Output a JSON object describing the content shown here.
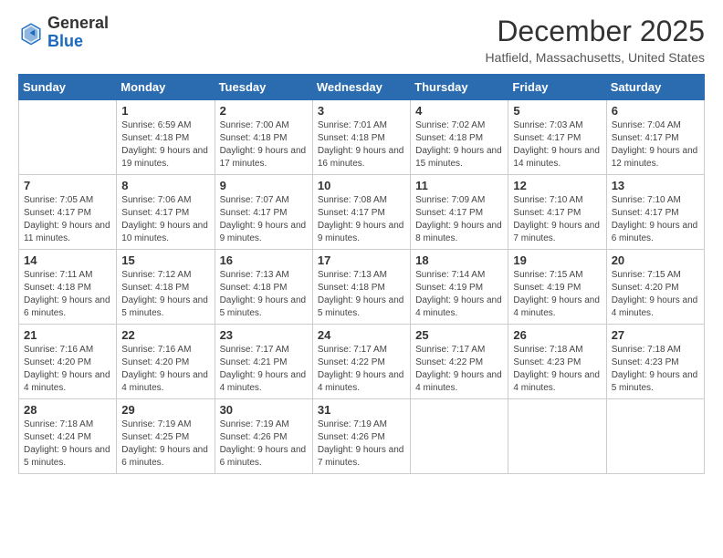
{
  "header": {
    "logo_general": "General",
    "logo_blue": "Blue",
    "month_year": "December 2025",
    "location": "Hatfield, Massachusetts, United States"
  },
  "days_of_week": [
    "Sunday",
    "Monday",
    "Tuesday",
    "Wednesday",
    "Thursday",
    "Friday",
    "Saturday"
  ],
  "weeks": [
    [
      {
        "day": "",
        "sunrise": "",
        "sunset": "",
        "daylight": ""
      },
      {
        "day": "1",
        "sunrise": "Sunrise: 6:59 AM",
        "sunset": "Sunset: 4:18 PM",
        "daylight": "Daylight: 9 hours and 19 minutes."
      },
      {
        "day": "2",
        "sunrise": "Sunrise: 7:00 AM",
        "sunset": "Sunset: 4:18 PM",
        "daylight": "Daylight: 9 hours and 17 minutes."
      },
      {
        "day": "3",
        "sunrise": "Sunrise: 7:01 AM",
        "sunset": "Sunset: 4:18 PM",
        "daylight": "Daylight: 9 hours and 16 minutes."
      },
      {
        "day": "4",
        "sunrise": "Sunrise: 7:02 AM",
        "sunset": "Sunset: 4:18 PM",
        "daylight": "Daylight: 9 hours and 15 minutes."
      },
      {
        "day": "5",
        "sunrise": "Sunrise: 7:03 AM",
        "sunset": "Sunset: 4:17 PM",
        "daylight": "Daylight: 9 hours and 14 minutes."
      },
      {
        "day": "6",
        "sunrise": "Sunrise: 7:04 AM",
        "sunset": "Sunset: 4:17 PM",
        "daylight": "Daylight: 9 hours and 12 minutes."
      }
    ],
    [
      {
        "day": "7",
        "sunrise": "Sunrise: 7:05 AM",
        "sunset": "Sunset: 4:17 PM",
        "daylight": "Daylight: 9 hours and 11 minutes."
      },
      {
        "day": "8",
        "sunrise": "Sunrise: 7:06 AM",
        "sunset": "Sunset: 4:17 PM",
        "daylight": "Daylight: 9 hours and 10 minutes."
      },
      {
        "day": "9",
        "sunrise": "Sunrise: 7:07 AM",
        "sunset": "Sunset: 4:17 PM",
        "daylight": "Daylight: 9 hours and 9 minutes."
      },
      {
        "day": "10",
        "sunrise": "Sunrise: 7:08 AM",
        "sunset": "Sunset: 4:17 PM",
        "daylight": "Daylight: 9 hours and 9 minutes."
      },
      {
        "day": "11",
        "sunrise": "Sunrise: 7:09 AM",
        "sunset": "Sunset: 4:17 PM",
        "daylight": "Daylight: 9 hours and 8 minutes."
      },
      {
        "day": "12",
        "sunrise": "Sunrise: 7:10 AM",
        "sunset": "Sunset: 4:17 PM",
        "daylight": "Daylight: 9 hours and 7 minutes."
      },
      {
        "day": "13",
        "sunrise": "Sunrise: 7:10 AM",
        "sunset": "Sunset: 4:17 PM",
        "daylight": "Daylight: 9 hours and 6 minutes."
      }
    ],
    [
      {
        "day": "14",
        "sunrise": "Sunrise: 7:11 AM",
        "sunset": "Sunset: 4:18 PM",
        "daylight": "Daylight: 9 hours and 6 minutes."
      },
      {
        "day": "15",
        "sunrise": "Sunrise: 7:12 AM",
        "sunset": "Sunset: 4:18 PM",
        "daylight": "Daylight: 9 hours and 5 minutes."
      },
      {
        "day": "16",
        "sunrise": "Sunrise: 7:13 AM",
        "sunset": "Sunset: 4:18 PM",
        "daylight": "Daylight: 9 hours and 5 minutes."
      },
      {
        "day": "17",
        "sunrise": "Sunrise: 7:13 AM",
        "sunset": "Sunset: 4:18 PM",
        "daylight": "Daylight: 9 hours and 5 minutes."
      },
      {
        "day": "18",
        "sunrise": "Sunrise: 7:14 AM",
        "sunset": "Sunset: 4:19 PM",
        "daylight": "Daylight: 9 hours and 4 minutes."
      },
      {
        "day": "19",
        "sunrise": "Sunrise: 7:15 AM",
        "sunset": "Sunset: 4:19 PM",
        "daylight": "Daylight: 9 hours and 4 minutes."
      },
      {
        "day": "20",
        "sunrise": "Sunrise: 7:15 AM",
        "sunset": "Sunset: 4:20 PM",
        "daylight": "Daylight: 9 hours and 4 minutes."
      }
    ],
    [
      {
        "day": "21",
        "sunrise": "Sunrise: 7:16 AM",
        "sunset": "Sunset: 4:20 PM",
        "daylight": "Daylight: 9 hours and 4 minutes."
      },
      {
        "day": "22",
        "sunrise": "Sunrise: 7:16 AM",
        "sunset": "Sunset: 4:20 PM",
        "daylight": "Daylight: 9 hours and 4 minutes."
      },
      {
        "day": "23",
        "sunrise": "Sunrise: 7:17 AM",
        "sunset": "Sunset: 4:21 PM",
        "daylight": "Daylight: 9 hours and 4 minutes."
      },
      {
        "day": "24",
        "sunrise": "Sunrise: 7:17 AM",
        "sunset": "Sunset: 4:22 PM",
        "daylight": "Daylight: 9 hours and 4 minutes."
      },
      {
        "day": "25",
        "sunrise": "Sunrise: 7:17 AM",
        "sunset": "Sunset: 4:22 PM",
        "daylight": "Daylight: 9 hours and 4 minutes."
      },
      {
        "day": "26",
        "sunrise": "Sunrise: 7:18 AM",
        "sunset": "Sunset: 4:23 PM",
        "daylight": "Daylight: 9 hours and 4 minutes."
      },
      {
        "day": "27",
        "sunrise": "Sunrise: 7:18 AM",
        "sunset": "Sunset: 4:23 PM",
        "daylight": "Daylight: 9 hours and 5 minutes."
      }
    ],
    [
      {
        "day": "28",
        "sunrise": "Sunrise: 7:18 AM",
        "sunset": "Sunset: 4:24 PM",
        "daylight": "Daylight: 9 hours and 5 minutes."
      },
      {
        "day": "29",
        "sunrise": "Sunrise: 7:19 AM",
        "sunset": "Sunset: 4:25 PM",
        "daylight": "Daylight: 9 hours and 6 minutes."
      },
      {
        "day": "30",
        "sunrise": "Sunrise: 7:19 AM",
        "sunset": "Sunset: 4:26 PM",
        "daylight": "Daylight: 9 hours and 6 minutes."
      },
      {
        "day": "31",
        "sunrise": "Sunrise: 7:19 AM",
        "sunset": "Sunset: 4:26 PM",
        "daylight": "Daylight: 9 hours and 7 minutes."
      },
      {
        "day": "",
        "sunrise": "",
        "sunset": "",
        "daylight": ""
      },
      {
        "day": "",
        "sunrise": "",
        "sunset": "",
        "daylight": ""
      },
      {
        "day": "",
        "sunrise": "",
        "sunset": "",
        "daylight": ""
      }
    ]
  ]
}
